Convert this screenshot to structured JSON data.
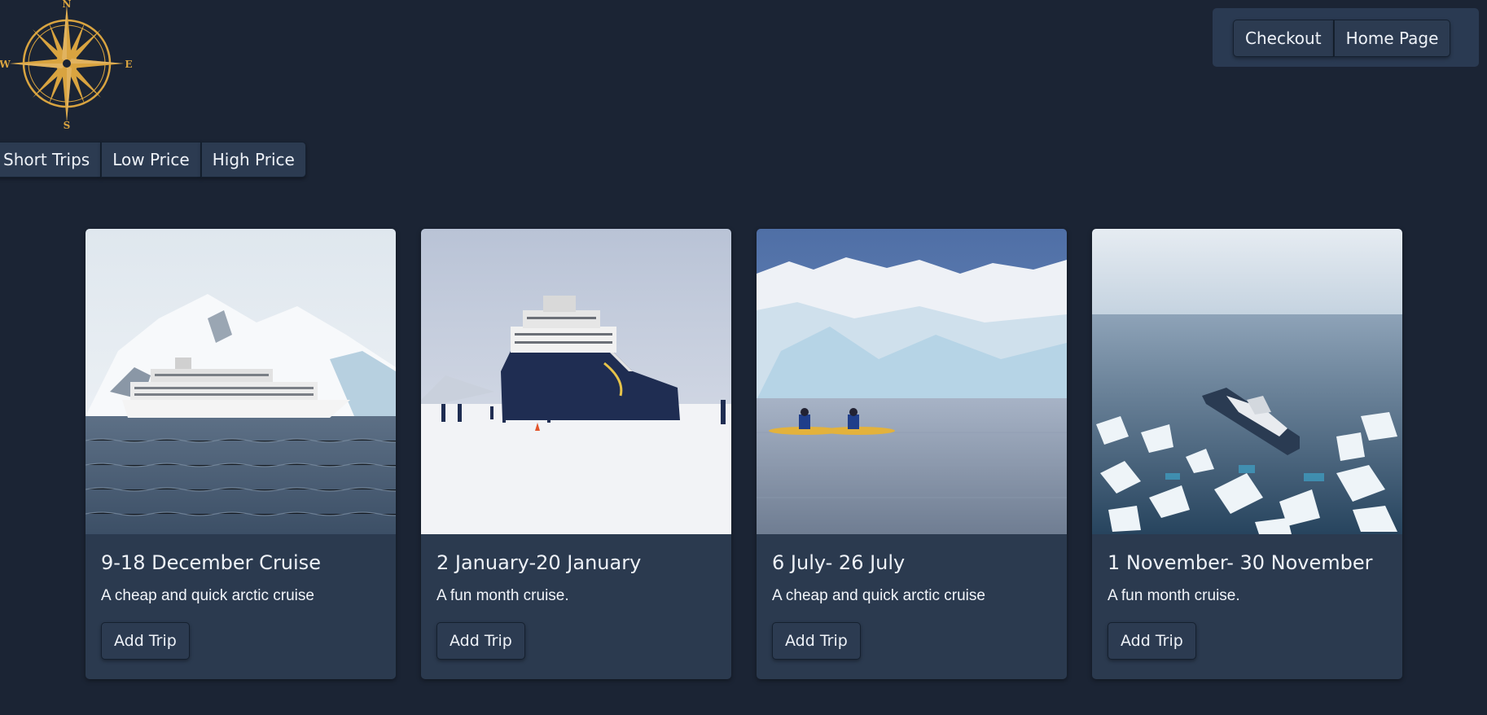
{
  "logo": {
    "icon": "compass-rose-icon",
    "north": "N",
    "south": "S",
    "east": "E",
    "west": "W"
  },
  "nav": {
    "checkout_label": "Checkout",
    "home_label": "Home Page"
  },
  "filters": {
    "short_trips_label": "Short Trips",
    "low_price_label": "Low Price",
    "high_price_label": "High Price"
  },
  "cards": [
    {
      "image": "cruise-ship-antarctic-mountains-photo",
      "title": "9-18 December Cruise",
      "text": "A cheap and quick arctic cruise",
      "button": "Add Trip"
    },
    {
      "image": "expedition-ship-on-ice-photo",
      "title": "2 January-20 January",
      "text": "A fun month cruise.",
      "button": "Add Trip"
    },
    {
      "image": "glacier-kayaks-photo",
      "title": "6 July- 26 July",
      "text": "A cheap and quick arctic cruise",
      "button": "Add Trip"
    },
    {
      "image": "ship-in-sea-ice-aerial-photo",
      "title": "1 November- 30 November",
      "text": "A fun month cruise.",
      "button": "Add Trip"
    }
  ],
  "colors": {
    "background": "#1b2434",
    "card": "#2b3a4f",
    "button": "#2c3b51",
    "compass_gold": "#d9a440"
  }
}
